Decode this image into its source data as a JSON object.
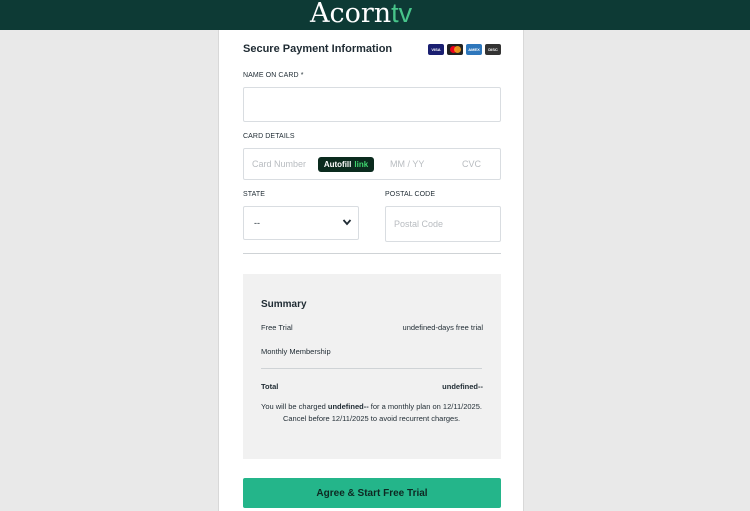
{
  "brand": {
    "name_main": "Acorn",
    "name_suffix": "tv"
  },
  "form": {
    "heading": "Secure Payment Information",
    "card_brands": [
      "VISA",
      "MC",
      "AMEX",
      "DISC"
    ],
    "name_label": "NAME ON CARD *",
    "name_value": "",
    "card_details_label": "CARD DETAILS",
    "card_number_placeholder": "Card Number",
    "autofill_label": "Autofill",
    "autofill_link": "link",
    "expiry_placeholder": "MM / YY",
    "cvc_placeholder": "CVC",
    "state_label": "STATE",
    "state_value": "--",
    "postal_label": "POSTAL CODE",
    "postal_placeholder": "Postal Code"
  },
  "summary": {
    "title": "Summary",
    "rows": [
      {
        "label": "Free Trial",
        "value": "undefined-days free trial"
      },
      {
        "label": "Monthly Membership",
        "value": ""
      }
    ],
    "total_label": "Total",
    "total_value": "undefined--",
    "notice_pre": "You will be charged ",
    "notice_amount": "undefined--",
    "notice_post": " for a monthly plan on 12/11/2025. Cancel before 12/11/2025 to avoid recurrent charges."
  },
  "cta": {
    "label": "Agree & Start Free Trial"
  },
  "colors": {
    "header": "#0d3a35",
    "accent": "#24b58a",
    "tv": "#47c58a"
  }
}
